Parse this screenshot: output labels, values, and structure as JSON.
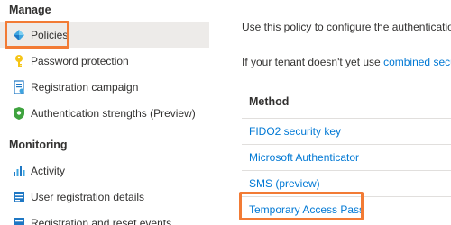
{
  "sidebar": {
    "manage_header": "Manage",
    "monitoring_header": "Monitoring",
    "manage_items": [
      {
        "label": "Policies",
        "icon": "policies-icon"
      },
      {
        "label": "Password protection",
        "icon": "key-icon"
      },
      {
        "label": "Registration campaign",
        "icon": "registration-icon"
      },
      {
        "label": "Authentication strengths (Preview)",
        "icon": "shield-icon"
      }
    ],
    "monitoring_items": [
      {
        "label": "Activity",
        "icon": "chart-icon"
      },
      {
        "label": "User registration details",
        "icon": "user-details-icon"
      },
      {
        "label": "Registration and reset events",
        "icon": "events-icon"
      }
    ]
  },
  "main": {
    "desc_line1": "Use this policy to configure the authentication",
    "desc_line2_prefix": "If your tenant doesn't yet use",
    "desc_line2_link": "combined secu",
    "column_header": "Method",
    "methods": [
      "FIDO2 security key",
      "Microsoft Authenticator",
      "SMS (preview)",
      "Temporary Access Pass"
    ]
  },
  "colors": {
    "highlight": "#f27b35",
    "link": "#0078d4",
    "selected_bg": "#edebe9"
  }
}
